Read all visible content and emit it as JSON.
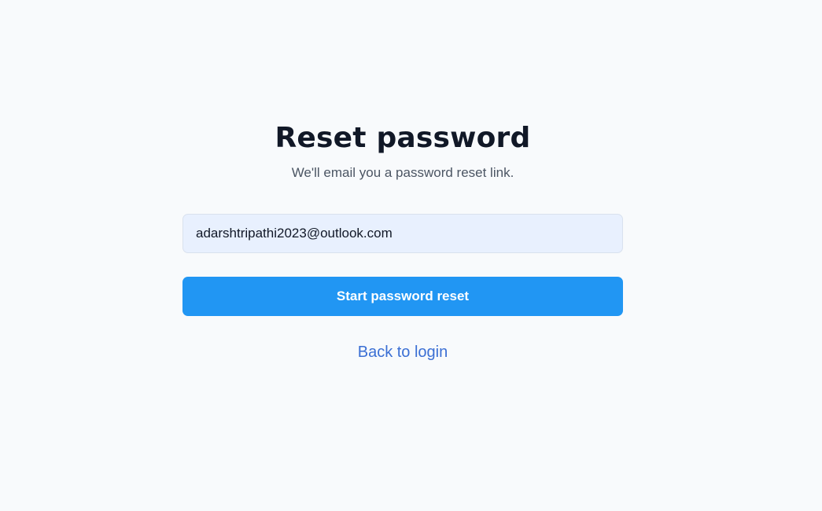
{
  "header": {
    "title": "Reset password",
    "subtitle": "We'll email you a password reset link."
  },
  "form": {
    "email": {
      "value": "adarshtripathi2023@outlook.com"
    },
    "submit_label": "Start password reset"
  },
  "footer": {
    "back_link_label": "Back to login"
  },
  "colors": {
    "background": "#f8fafc",
    "title": "#111827",
    "subtitle": "#4b5563",
    "input_background": "#e8f0fe",
    "button_accent": "#2196f3",
    "link": "#3b6fd4"
  }
}
